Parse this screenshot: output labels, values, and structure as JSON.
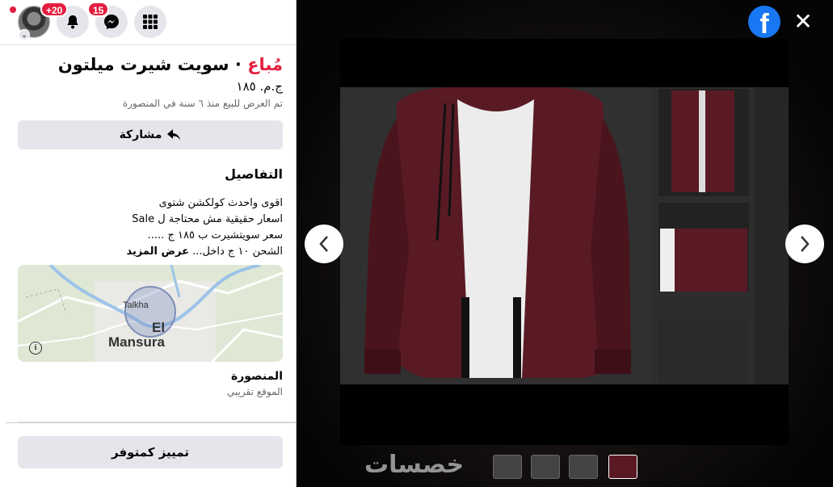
{
  "topbar": {
    "notifications_count": "+20",
    "messenger_count": "15"
  },
  "listing": {
    "status_label": "مُباع",
    "separator": " · ",
    "title": "سويت شيرت ميلتون",
    "price": "ج.م. ١٨٥",
    "listed_text": "تم العرض للبيع منذ ٦ سنة في المنصورة",
    "share_label": "مشاركة",
    "details_heading": "التفاصيل",
    "description_lines": [
      "اقوى واحدث كولكشن شتوى",
      "اسعار حقيقية مش محتاجة ل Sale",
      "سعر سويتشيرت  ب ١٨٥ ج .....",
      "الشحن ١٠ ج داخل..."
    ],
    "see_more": "عرض المزيد",
    "location_name": "المنصورة",
    "location_sub": "الموقع تقريبي",
    "mark_available": "تمييز كمتوفر"
  },
  "map": {
    "label_talkha": "Talkha",
    "label_el": "El",
    "label_mansura": "Mansura",
    "info_icon": "i"
  },
  "viewer": {
    "watermark": "خصسات",
    "logo_letter": "f",
    "close_glyph": "✕"
  },
  "colors": {
    "sold_red": "#e41e3f",
    "fb_blue": "#1877f2",
    "button_grey": "#e4e6eb",
    "jacket": "#5a1a24"
  }
}
